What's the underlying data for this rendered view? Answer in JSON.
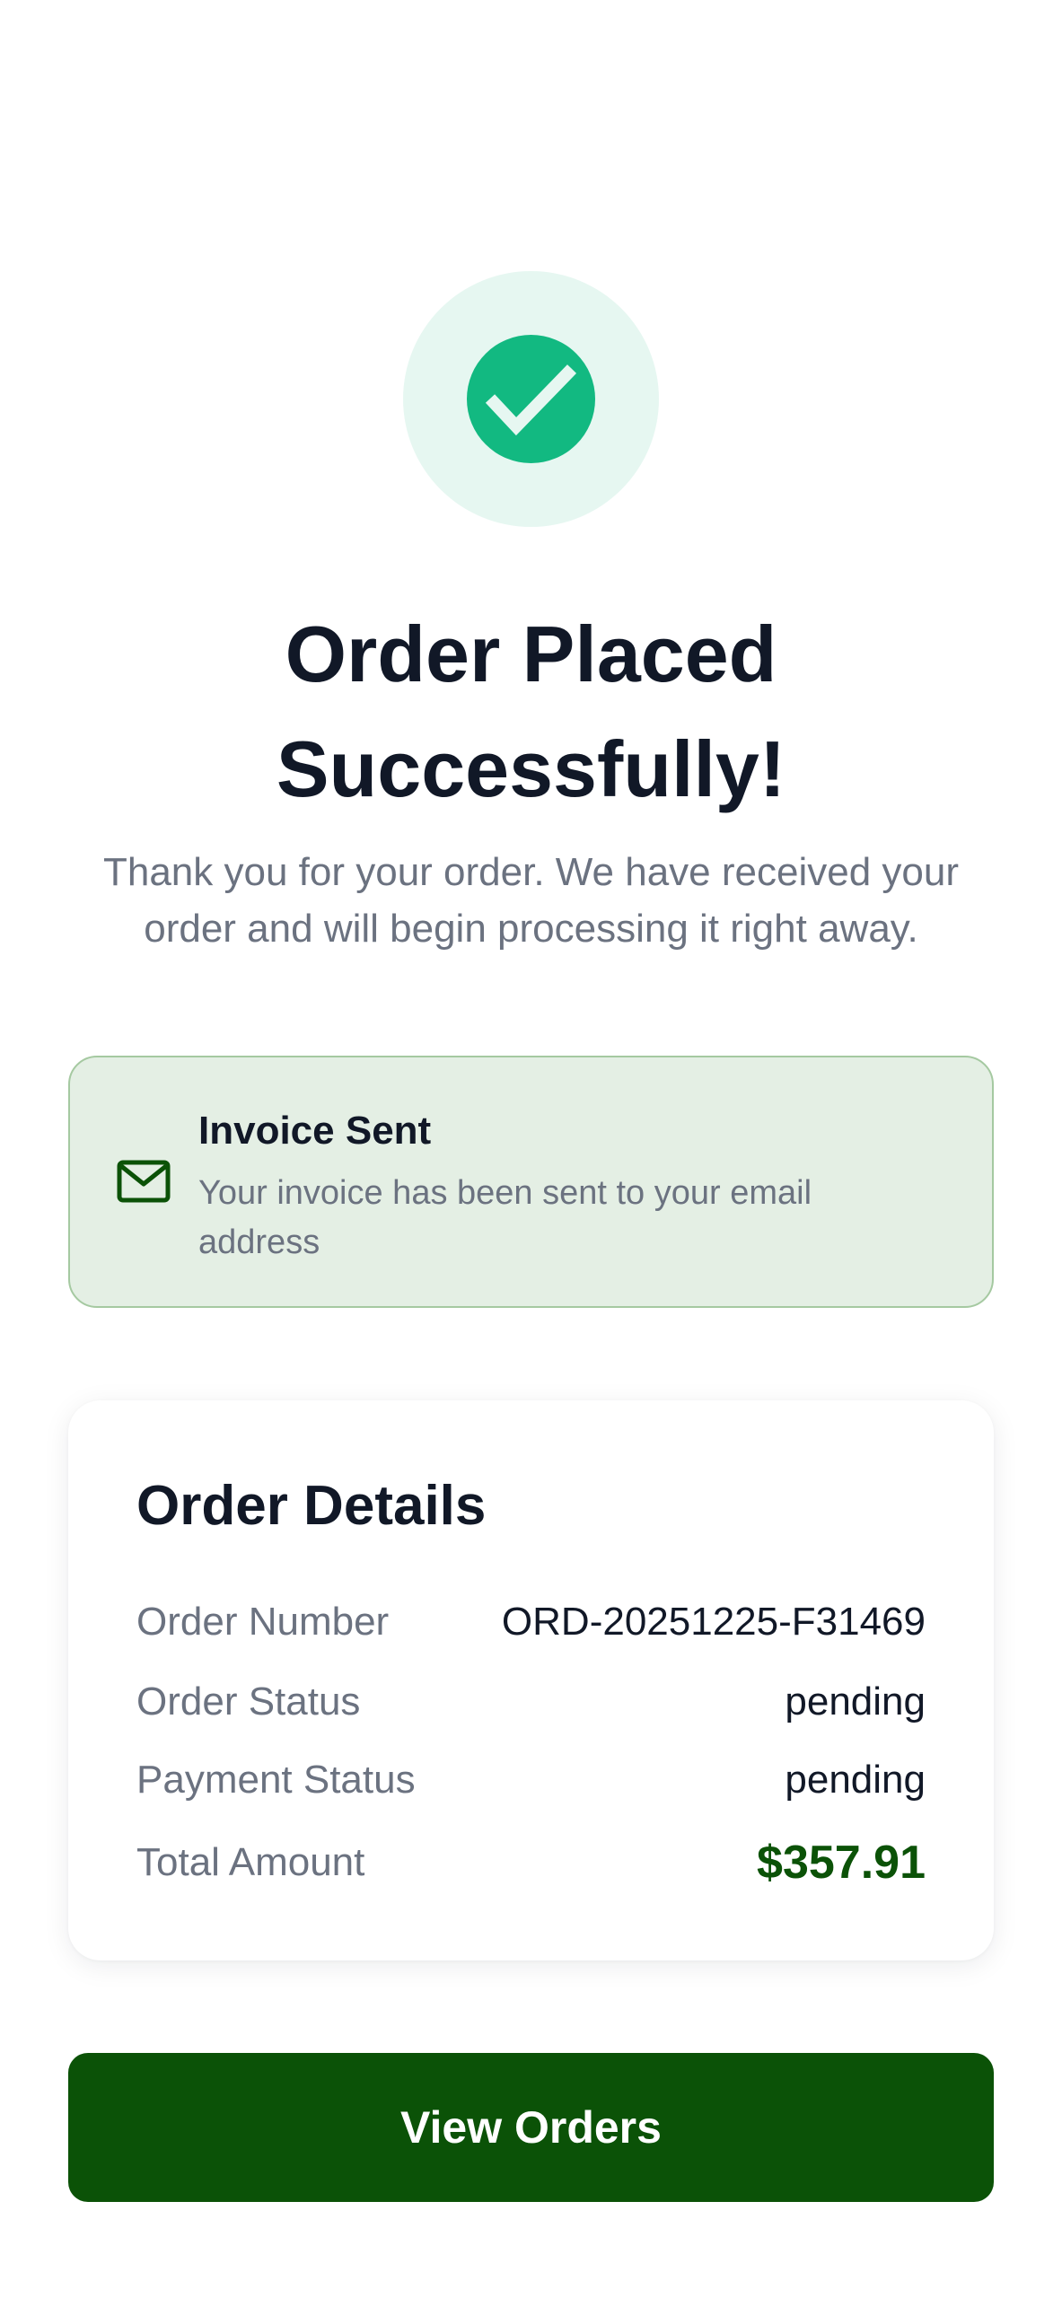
{
  "success": {
    "icon": "check-circle-icon",
    "accent_color": "#12b981",
    "ring_color": "#e6f7f1"
  },
  "title": "Order Placed Successfully!",
  "message": "Thank you for your order. We have received your order and will begin processing it right away.",
  "invoice": {
    "icon": "mail-icon",
    "title": "Invoice Sent",
    "text": "Your invoice has been sent to your email address",
    "background_color": "#e4efe4",
    "icon_color": "#0b5207"
  },
  "order_details": {
    "title": "Order Details",
    "rows": [
      {
        "label": "Order Number",
        "value": "ORD-20251225-F31469"
      },
      {
        "label": "Order Status",
        "value": "pending"
      },
      {
        "label": "Payment Status",
        "value": "pending"
      },
      {
        "label": "Total Amount",
        "value": "$357.91"
      }
    ],
    "total_color": "#0b5207"
  },
  "button": {
    "label": "View Orders",
    "color": "#0b5207"
  }
}
